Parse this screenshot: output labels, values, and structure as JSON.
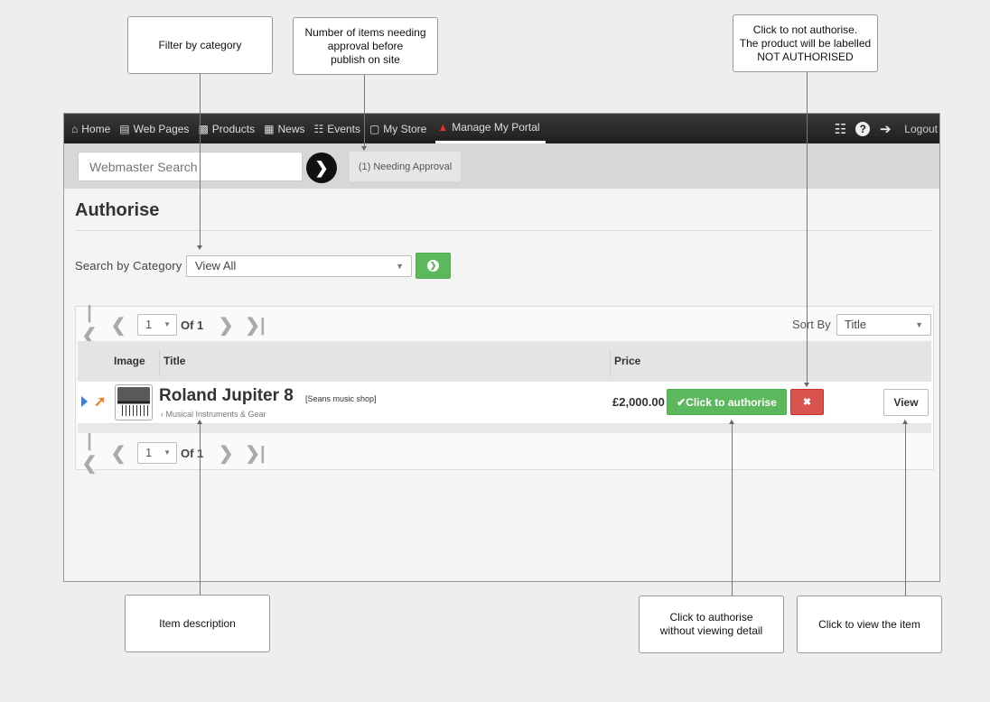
{
  "callouts": {
    "filter": "Filter by category",
    "needing": "Number of items needing\napproval before\npublish on site",
    "not_authorise": "Click to not authorise.\nThe product will be labelled\nNOT AUTHORISED",
    "item_description": "Item description",
    "authorise_without": "Click to authorise\nwithout viewing detail",
    "view_item": "Click to view the item"
  },
  "nav": {
    "items": [
      {
        "label": "Home",
        "icon": "home-icon"
      },
      {
        "label": "Web Pages",
        "icon": "web-pages-icon"
      },
      {
        "label": "Products",
        "icon": "products-icon"
      },
      {
        "label": "News",
        "icon": "news-icon"
      },
      {
        "label": "Events",
        "icon": "calendar-icon"
      },
      {
        "label": "My Store",
        "icon": "cart-icon"
      },
      {
        "label": "Manage My Portal",
        "icon": "sitemap-icon"
      }
    ],
    "logout": "Logout"
  },
  "search": {
    "placeholder": "Webmaster Search",
    "needing_approval": "(1) Needing Approval"
  },
  "page": {
    "title": "Authorise",
    "category_label": "Search by Category",
    "category_value": "View All"
  },
  "pager": {
    "page": "1",
    "of": "Of 1"
  },
  "sort": {
    "label": "Sort By",
    "value": "Title"
  },
  "table": {
    "headers": {
      "image": "Image",
      "title": "Title",
      "price": "Price"
    },
    "row": {
      "title": "Roland Jupiter 8",
      "shop": "[Seans music shop]",
      "category": "‹ Musical Instruments & Gear",
      "price": "£2,000.00",
      "authorise_label": "✔Click to authorise",
      "reject_label": "✖",
      "view_label": "View"
    }
  },
  "colors": {
    "accent_green": "#5cb85c",
    "danger_red": "#d9534f",
    "nav_dark": "#2a2a2a"
  }
}
